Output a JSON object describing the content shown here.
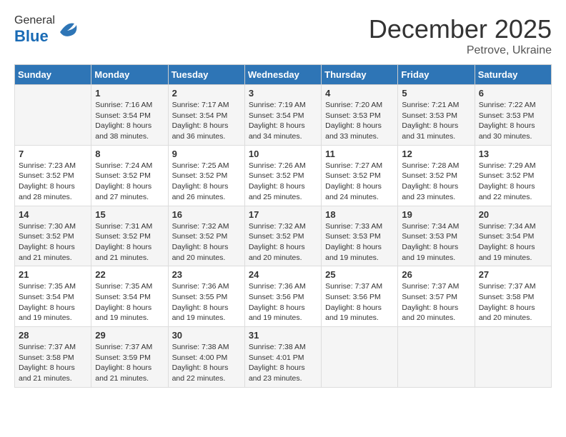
{
  "header": {
    "logo_general": "General",
    "logo_blue": "Blue",
    "month_title": "December 2025",
    "location": "Petrove, Ukraine"
  },
  "weekdays": [
    "Sunday",
    "Monday",
    "Tuesday",
    "Wednesday",
    "Thursday",
    "Friday",
    "Saturday"
  ],
  "weeks": [
    [
      {
        "day": null,
        "sunrise": null,
        "sunset": null,
        "daylight": null
      },
      {
        "day": "1",
        "sunrise": "Sunrise: 7:16 AM",
        "sunset": "Sunset: 3:54 PM",
        "daylight": "Daylight: 8 hours and 38 minutes."
      },
      {
        "day": "2",
        "sunrise": "Sunrise: 7:17 AM",
        "sunset": "Sunset: 3:54 PM",
        "daylight": "Daylight: 8 hours and 36 minutes."
      },
      {
        "day": "3",
        "sunrise": "Sunrise: 7:19 AM",
        "sunset": "Sunset: 3:54 PM",
        "daylight": "Daylight: 8 hours and 34 minutes."
      },
      {
        "day": "4",
        "sunrise": "Sunrise: 7:20 AM",
        "sunset": "Sunset: 3:53 PM",
        "daylight": "Daylight: 8 hours and 33 minutes."
      },
      {
        "day": "5",
        "sunrise": "Sunrise: 7:21 AM",
        "sunset": "Sunset: 3:53 PM",
        "daylight": "Daylight: 8 hours and 31 minutes."
      },
      {
        "day": "6",
        "sunrise": "Sunrise: 7:22 AM",
        "sunset": "Sunset: 3:53 PM",
        "daylight": "Daylight: 8 hours and 30 minutes."
      }
    ],
    [
      {
        "day": "7",
        "sunrise": "Sunrise: 7:23 AM",
        "sunset": "Sunset: 3:52 PM",
        "daylight": "Daylight: 8 hours and 28 minutes."
      },
      {
        "day": "8",
        "sunrise": "Sunrise: 7:24 AM",
        "sunset": "Sunset: 3:52 PM",
        "daylight": "Daylight: 8 hours and 27 minutes."
      },
      {
        "day": "9",
        "sunrise": "Sunrise: 7:25 AM",
        "sunset": "Sunset: 3:52 PM",
        "daylight": "Daylight: 8 hours and 26 minutes."
      },
      {
        "day": "10",
        "sunrise": "Sunrise: 7:26 AM",
        "sunset": "Sunset: 3:52 PM",
        "daylight": "Daylight: 8 hours and 25 minutes."
      },
      {
        "day": "11",
        "sunrise": "Sunrise: 7:27 AM",
        "sunset": "Sunset: 3:52 PM",
        "daylight": "Daylight: 8 hours and 24 minutes."
      },
      {
        "day": "12",
        "sunrise": "Sunrise: 7:28 AM",
        "sunset": "Sunset: 3:52 PM",
        "daylight": "Daylight: 8 hours and 23 minutes."
      },
      {
        "day": "13",
        "sunrise": "Sunrise: 7:29 AM",
        "sunset": "Sunset: 3:52 PM",
        "daylight": "Daylight: 8 hours and 22 minutes."
      }
    ],
    [
      {
        "day": "14",
        "sunrise": "Sunrise: 7:30 AM",
        "sunset": "Sunset: 3:52 PM",
        "daylight": "Daylight: 8 hours and 21 minutes."
      },
      {
        "day": "15",
        "sunrise": "Sunrise: 7:31 AM",
        "sunset": "Sunset: 3:52 PM",
        "daylight": "Daylight: 8 hours and 21 minutes."
      },
      {
        "day": "16",
        "sunrise": "Sunrise: 7:32 AM",
        "sunset": "Sunset: 3:52 PM",
        "daylight": "Daylight: 8 hours and 20 minutes."
      },
      {
        "day": "17",
        "sunrise": "Sunrise: 7:32 AM",
        "sunset": "Sunset: 3:52 PM",
        "daylight": "Daylight: 8 hours and 20 minutes."
      },
      {
        "day": "18",
        "sunrise": "Sunrise: 7:33 AM",
        "sunset": "Sunset: 3:53 PM",
        "daylight": "Daylight: 8 hours and 19 minutes."
      },
      {
        "day": "19",
        "sunrise": "Sunrise: 7:34 AM",
        "sunset": "Sunset: 3:53 PM",
        "daylight": "Daylight: 8 hours and 19 minutes."
      },
      {
        "day": "20",
        "sunrise": "Sunrise: 7:34 AM",
        "sunset": "Sunset: 3:54 PM",
        "daylight": "Daylight: 8 hours and 19 minutes."
      }
    ],
    [
      {
        "day": "21",
        "sunrise": "Sunrise: 7:35 AM",
        "sunset": "Sunset: 3:54 PM",
        "daylight": "Daylight: 8 hours and 19 minutes."
      },
      {
        "day": "22",
        "sunrise": "Sunrise: 7:35 AM",
        "sunset": "Sunset: 3:54 PM",
        "daylight": "Daylight: 8 hours and 19 minutes."
      },
      {
        "day": "23",
        "sunrise": "Sunrise: 7:36 AM",
        "sunset": "Sunset: 3:55 PM",
        "daylight": "Daylight: 8 hours and 19 minutes."
      },
      {
        "day": "24",
        "sunrise": "Sunrise: 7:36 AM",
        "sunset": "Sunset: 3:56 PM",
        "daylight": "Daylight: 8 hours and 19 minutes."
      },
      {
        "day": "25",
        "sunrise": "Sunrise: 7:37 AM",
        "sunset": "Sunset: 3:56 PM",
        "daylight": "Daylight: 8 hours and 19 minutes."
      },
      {
        "day": "26",
        "sunrise": "Sunrise: 7:37 AM",
        "sunset": "Sunset: 3:57 PM",
        "daylight": "Daylight: 8 hours and 20 minutes."
      },
      {
        "day": "27",
        "sunrise": "Sunrise: 7:37 AM",
        "sunset": "Sunset: 3:58 PM",
        "daylight": "Daylight: 8 hours and 20 minutes."
      }
    ],
    [
      {
        "day": "28",
        "sunrise": "Sunrise: 7:37 AM",
        "sunset": "Sunset: 3:58 PM",
        "daylight": "Daylight: 8 hours and 21 minutes."
      },
      {
        "day": "29",
        "sunrise": "Sunrise: 7:37 AM",
        "sunset": "Sunset: 3:59 PM",
        "daylight": "Daylight: 8 hours and 21 minutes."
      },
      {
        "day": "30",
        "sunrise": "Sunrise: 7:38 AM",
        "sunset": "Sunset: 4:00 PM",
        "daylight": "Daylight: 8 hours and 22 minutes."
      },
      {
        "day": "31",
        "sunrise": "Sunrise: 7:38 AM",
        "sunset": "Sunset: 4:01 PM",
        "daylight": "Daylight: 8 hours and 23 minutes."
      },
      {
        "day": null,
        "sunrise": null,
        "sunset": null,
        "daylight": null
      },
      {
        "day": null,
        "sunrise": null,
        "sunset": null,
        "daylight": null
      },
      {
        "day": null,
        "sunrise": null,
        "sunset": null,
        "daylight": null
      }
    ]
  ]
}
